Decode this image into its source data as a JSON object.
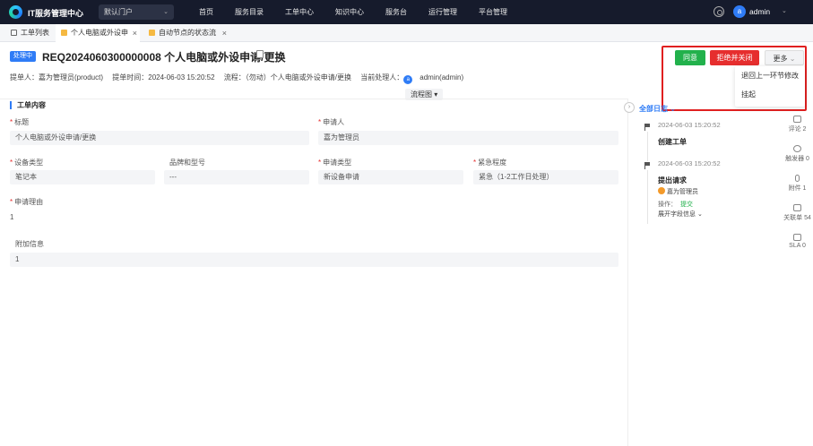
{
  "topbar": {
    "app_title": "IT服务管理中心",
    "portal": "默认门户",
    "nav": [
      "首页",
      "服务目录",
      "工单中心",
      "知识中心",
      "服务台",
      "运行管理",
      "平台管理"
    ],
    "user_initial": "a",
    "user_name": "admin"
  },
  "tabs": [
    {
      "label": "工单列表"
    },
    {
      "label": "个人电脑或外设申"
    },
    {
      "label": "自动节点的状态流"
    }
  ],
  "ticket": {
    "status": "处理中",
    "title": "REQ2024060300000008 个人电脑或外设申请/更换",
    "submitter": "提单人：嘉为管理员(product)",
    "submit_time": "提单时间：2024-06-03 15:20:52",
    "flow": "流程：（勿动）个人电脑或外设申请/更换",
    "handler_label": "当前处理人：",
    "handler_initial": "a",
    "handler": "admin(admin)"
  },
  "actions": {
    "agree": "同意",
    "reject": "拒绝并关闭",
    "more": "更多",
    "more_items": [
      "退回上一环节修改",
      "挂起"
    ]
  },
  "flow_chart_label": "流程图",
  "form": {
    "section_title": "工单内容",
    "title_label": "标题",
    "title_value": "个人电脑或外设申请/更换",
    "applicant_label": "申请人",
    "applicant_value": "嘉为管理员",
    "device_type_label": "设备类型",
    "device_type_value": "笔记本",
    "brand_label": "品牌和型号",
    "brand_value": "---",
    "apply_type_label": "申请类型",
    "apply_type_value": "新设备申请",
    "urgency_label": "紧急程度",
    "urgency_value": "紧急（1-2工作日处理）",
    "reason_label": "申请理由",
    "reason_value": "1",
    "extra_label": "附加信息",
    "extra_value": "1"
  },
  "timeline": {
    "filter": "全部日志",
    "entries": [
      {
        "time": "2024-06-03 15:20:52",
        "title": "创建工单"
      },
      {
        "time": "2024-06-03 15:20:52",
        "title": "提出请求",
        "user": "嘉为管理员",
        "op_label": "操作：",
        "op_value": "提交",
        "expand": "展开字段信息"
      }
    ]
  },
  "side": [
    {
      "label": "评论 2"
    },
    {
      "label": "触发器 0"
    },
    {
      "label": "附件 1"
    },
    {
      "label": "关联单 54"
    },
    {
      "label": "SLA 0"
    }
  ],
  "colors": {
    "primary": "#2f7cf6",
    "success": "#22b14c",
    "danger": "#e62e2e",
    "topbar": "#161b2c"
  }
}
